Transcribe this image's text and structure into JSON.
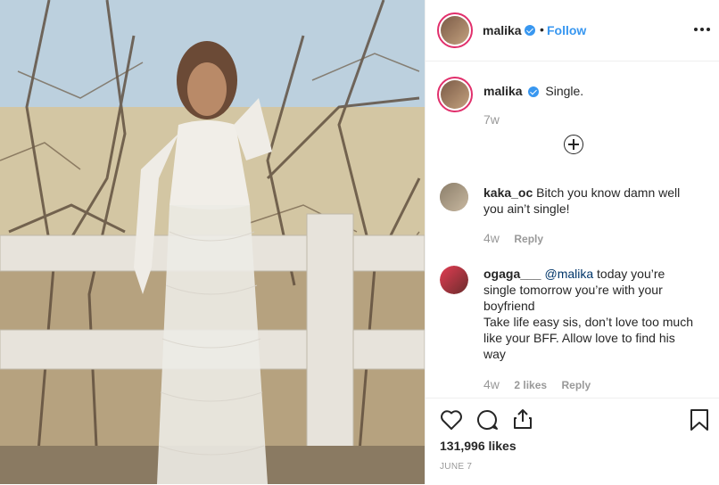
{
  "post": {
    "author": "malika",
    "follow_label": "Follow",
    "dot": "•",
    "more_icon": "more-horizontal-icon"
  },
  "caption": {
    "author": "malika",
    "text": "Single.",
    "age": "7w"
  },
  "comments": [
    {
      "author": "kaka_oc",
      "lines": [
        "Bitch you know damn well",
        "you ain’t single!"
      ],
      "age": "4w",
      "likes": "",
      "reply_label": "Reply"
    },
    {
      "author": "ogaga___",
      "mention": "@malika",
      "lines": [
        "today you’re",
        "single tomorrow you’re with your",
        "boyfriend",
        "Take life easy sis, don’t love too much",
        "like your BFF. Allow love to find his",
        "way"
      ],
      "age": "4w",
      "likes": "2 likes",
      "reply_label": "Reply"
    }
  ],
  "actions": {
    "likes_count": "131,996 likes",
    "date": "JUNE 7"
  },
  "icons": [
    "heart-icon",
    "comment-icon",
    "share-icon",
    "bookmark-icon",
    "load-more-icon"
  ]
}
